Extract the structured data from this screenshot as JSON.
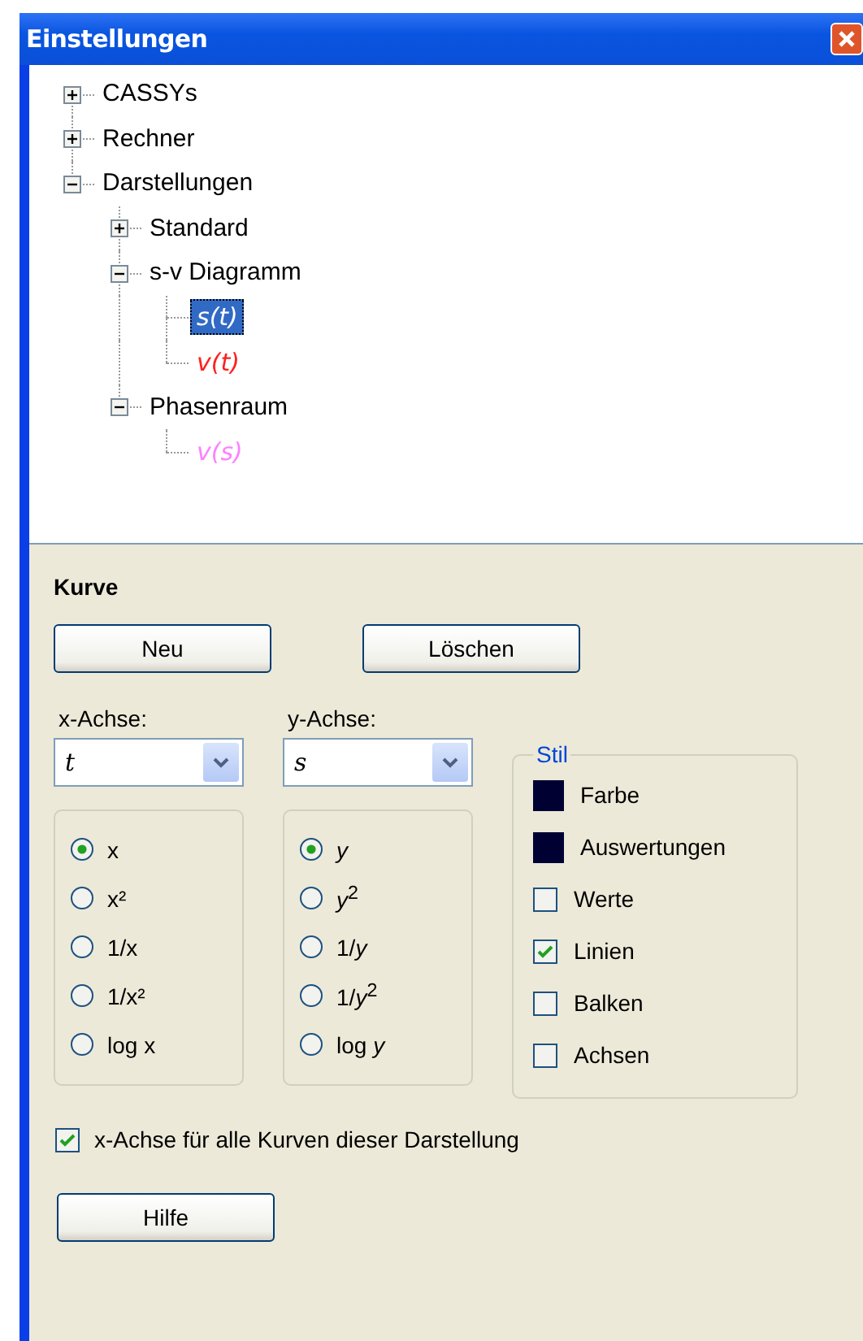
{
  "window": {
    "title": "Einstellungen"
  },
  "tree": [
    {
      "label": "CASSYs",
      "kind": "folder",
      "expanded": false,
      "selected": false
    },
    {
      "label": "Rechner",
      "kind": "folder",
      "expanded": false,
      "selected": false
    },
    {
      "label": "Darstellungen",
      "kind": "folder",
      "expanded": true,
      "selected": false,
      "children": [
        {
          "label": "Standard",
          "kind": "folder",
          "expanded": false,
          "selected": false
        },
        {
          "label": "s-v Diagramm",
          "kind": "folder",
          "expanded": true,
          "selected": false,
          "children": [
            {
              "label": "s(t)",
              "kind": "curve",
              "selected": true
            },
            {
              "label": "v(t)",
              "kind": "curve",
              "color": "#ff2020",
              "selected": false
            }
          ]
        },
        {
          "label": "Phasenraum",
          "kind": "folder",
          "expanded": true,
          "selected": false,
          "children": [
            {
              "label": "v(s)",
              "kind": "curve",
              "color": "#ff80ff",
              "selected": false
            }
          ]
        }
      ]
    }
  ],
  "panel": {
    "title": "Kurve",
    "buttons": [
      "Neu",
      "Löschen"
    ],
    "x_axis": {
      "label": "x-Achse:",
      "value": "t",
      "options": [
        {
          "label": "x",
          "selected": true
        },
        {
          "label": "x²",
          "selected": false
        },
        {
          "label": "1/x",
          "selected": false
        },
        {
          "label": "1/x²",
          "selected": false
        },
        {
          "label": "log x",
          "selected": false
        }
      ]
    },
    "y_axis": {
      "label": "y-Achse:",
      "value": "s",
      "options": [
        {
          "label": "*y*",
          "selected": true
        },
        {
          "label": "*y*$^{2}$",
          "selected": false
        },
        {
          "label": "1/*y*",
          "selected": false
        },
        {
          "label": "1/*y*$^{2}$",
          "selected": false
        },
        {
          "label": "log *y*",
          "selected": false
        }
      ]
    },
    "style": {
      "title": "Stil",
      "items": [
        {
          "kind": "color",
          "label": "Farbe",
          "color": "#000033"
        },
        {
          "kind": "color",
          "label": "Auswertungen",
          "color": "#000033"
        },
        {
          "kind": "checkbox",
          "label": "Werte",
          "checked": false
        },
        {
          "kind": "checkbox",
          "label": "Linien",
          "checked": true
        },
        {
          "kind": "checkbox",
          "label": "Balken",
          "checked": false
        },
        {
          "kind": "checkbox",
          "label": "Achsen",
          "checked": false
        }
      ]
    },
    "shared_x": {
      "label": "x-Achse für alle Kurven dieser Darstellung",
      "checked": true
    },
    "help_button": "Hilfe"
  }
}
